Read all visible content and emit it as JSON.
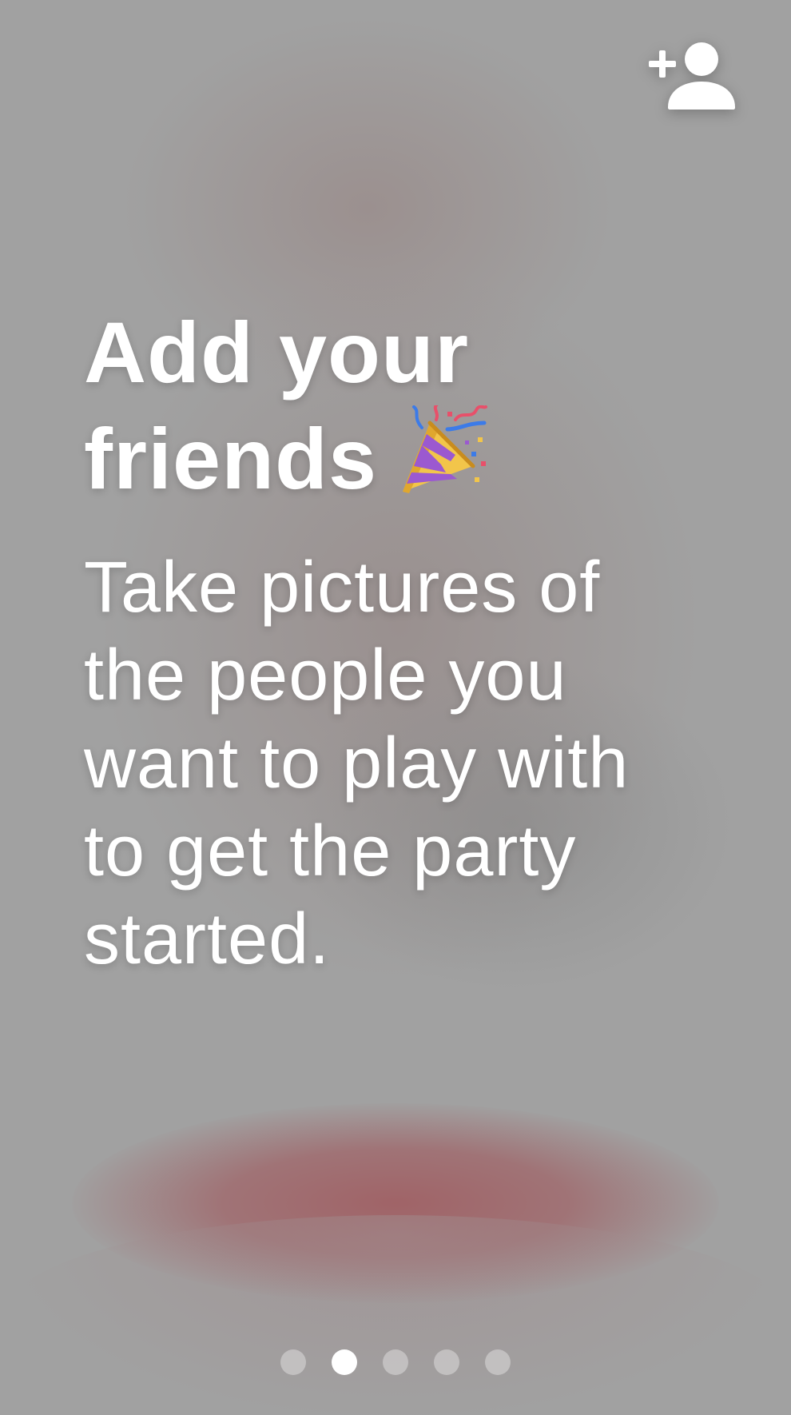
{
  "header": {
    "add_friend_icon": "person-add-icon"
  },
  "onboarding": {
    "title_line1": "Add your",
    "title_line2": "friends",
    "title_emoji": "party-popper-icon",
    "body_lines": [
      "Take pictures of",
      "the people you",
      "want to play with",
      "to get the party",
      "started."
    ]
  },
  "pagination": {
    "total_pages": 5,
    "active_page": 2
  },
  "colors": {
    "text": "#ffffff",
    "background": "#a1a1a1",
    "accent_blur": "#a06064"
  }
}
